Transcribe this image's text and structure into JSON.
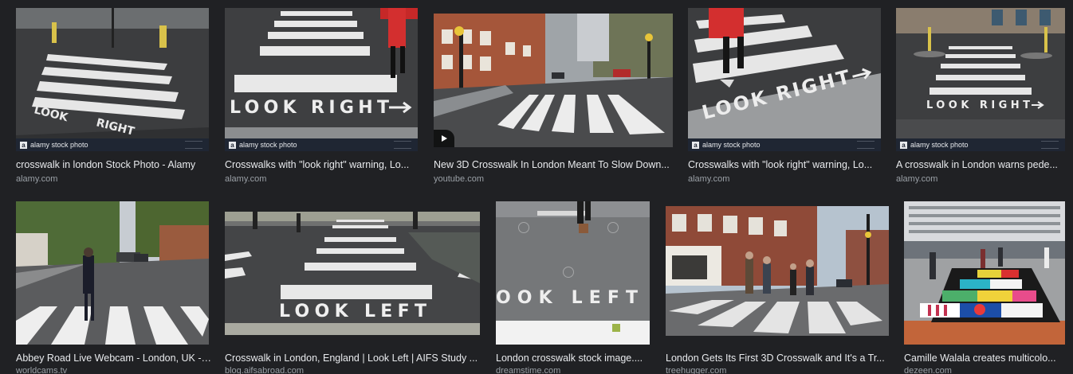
{
  "results": [
    {
      "caption": "crosswalk in london Stock Photo - Alamy",
      "source": "alamy.com",
      "watermark": "alamy stock photo",
      "icon": "image-thumbnail"
    },
    {
      "caption": "Crosswalks with \"look right\" warning, Lo...",
      "source": "alamy.com",
      "watermark": "alamy stock photo",
      "painted_text": "LOOK RIGHT",
      "icon": "image-thumbnail"
    },
    {
      "caption": "New 3D Crosswalk In London Meant To Slow Down...",
      "source": "youtube.com",
      "icon": "play-icon"
    },
    {
      "caption": "Crosswalks with \"look right\" warning, Lo...",
      "source": "alamy.com",
      "watermark": "alamy stock photo",
      "painted_text": "LOOK RIGHT",
      "icon": "image-thumbnail"
    },
    {
      "caption": "A crosswalk in London warns pede...",
      "source": "alamy.com",
      "watermark": "alamy stock photo",
      "painted_text": "LOOK RIGHT",
      "icon": "image-thumbnail"
    },
    {
      "caption": "Abbey Road Live Webcam - London, UK - ...",
      "source": "worldcams.tv",
      "icon": "image-thumbnail"
    },
    {
      "caption": "Crosswalk in London, England | Look Left | AIFS Study ...",
      "source": "blog.aifsabroad.com",
      "painted_text": "LOOK LEFT",
      "icon": "image-thumbnail"
    },
    {
      "caption": "London crosswalk stock image....",
      "source": "dreamstime.com",
      "painted_text": "OOK LEFT",
      "icon": "image-thumbnail"
    },
    {
      "caption": "London Gets Its First 3D Crosswalk and It's a Tr...",
      "source": "treehugger.com",
      "icon": "image-thumbnail"
    },
    {
      "caption": "Camille Walala creates multicolo...",
      "source": "dezeen.com",
      "icon": "image-thumbnail"
    }
  ]
}
